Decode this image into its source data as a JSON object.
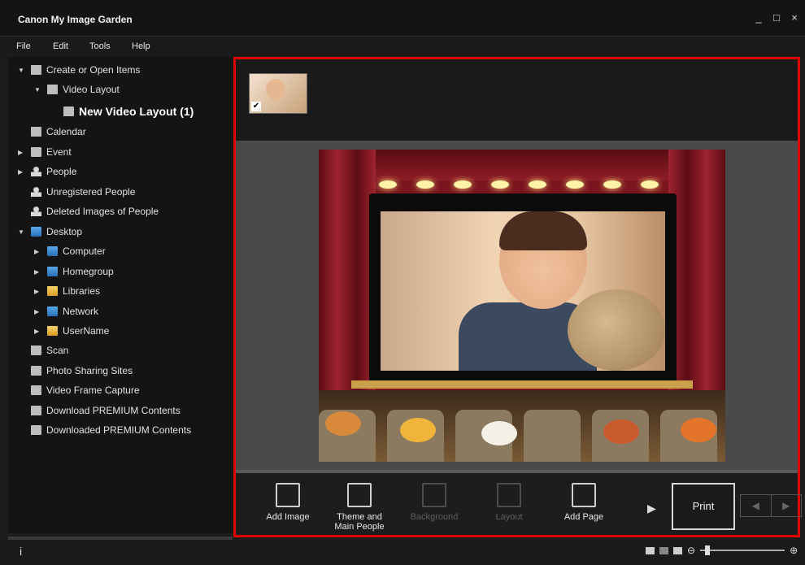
{
  "window": {
    "title": "Canon My Image Garden",
    "controls": [
      "_",
      "□",
      "×"
    ]
  },
  "menu": [
    "File",
    "Edit",
    "Tools",
    "Help"
  ],
  "sidebar": {
    "items": [
      {
        "label": "Create or Open Items",
        "icon": "create-items-icon",
        "arrow": "▼"
      },
      {
        "label": "Video Layout",
        "icon": "video-layout-icon",
        "arrow": "▼"
      },
      {
        "label": "New Video Layout (1)",
        "icon": "video-layout-item-icon",
        "arrow": ""
      },
      {
        "label": "Calendar",
        "icon": "calendar-icon",
        "arrow": ""
      },
      {
        "label": "Event",
        "icon": "event-icon",
        "arrow": "▶"
      },
      {
        "label": "People",
        "icon": "people-icon",
        "arrow": "▶"
      },
      {
        "label": "Unregistered People",
        "icon": "unregistered-people-icon",
        "arrow": ""
      },
      {
        "label": "Deleted Images of People",
        "icon": "deleted-people-icon",
        "arrow": ""
      },
      {
        "label": "Desktop",
        "icon": "desktop-icon",
        "arrow": "▼"
      },
      {
        "label": "Computer",
        "icon": "computer-icon",
        "arrow": "▶"
      },
      {
        "label": "Homegroup",
        "icon": "homegroup-icon",
        "arrow": "▶"
      },
      {
        "label": "Libraries",
        "icon": "libraries-icon",
        "arrow": "▶"
      },
      {
        "label": "Network",
        "icon": "network-icon",
        "arrow": "▶"
      },
      {
        "label": "UserName",
        "icon": "username-icon",
        "arrow": "▶"
      },
      {
        "label": "Scan",
        "icon": "scan-icon",
        "arrow": ""
      },
      {
        "label": "Photo Sharing Sites",
        "icon": "photo-sharing-icon",
        "arrow": ""
      },
      {
        "label": "Video Frame Capture",
        "icon": "video-frame-icon",
        "arrow": ""
      },
      {
        "label": "Download PREMIUM Contents",
        "icon": "download-premium-icon",
        "arrow": ""
      },
      {
        "label": "Downloaded PREMIUM Contents",
        "icon": "downloaded-premium-icon",
        "arrow": ""
      }
    ]
  },
  "toolbar": {
    "add_image": "Add Image",
    "theme_main_people_1": "Theme and",
    "theme_main_people_2": "Main People",
    "background": "Background",
    "layout": "Layout",
    "add_page": "Add Page",
    "print": "Print",
    "next_arrow": "▶",
    "prev_page": "◀",
    "next_page": "▶"
  },
  "thumb": {
    "checked": "✔"
  },
  "statusbar": {
    "info": "i",
    "zoom_out": "⊖",
    "zoom_in": "⊕"
  },
  "colors": {
    "highlight_border": "#e00000",
    "background": "#1c1c1c"
  }
}
